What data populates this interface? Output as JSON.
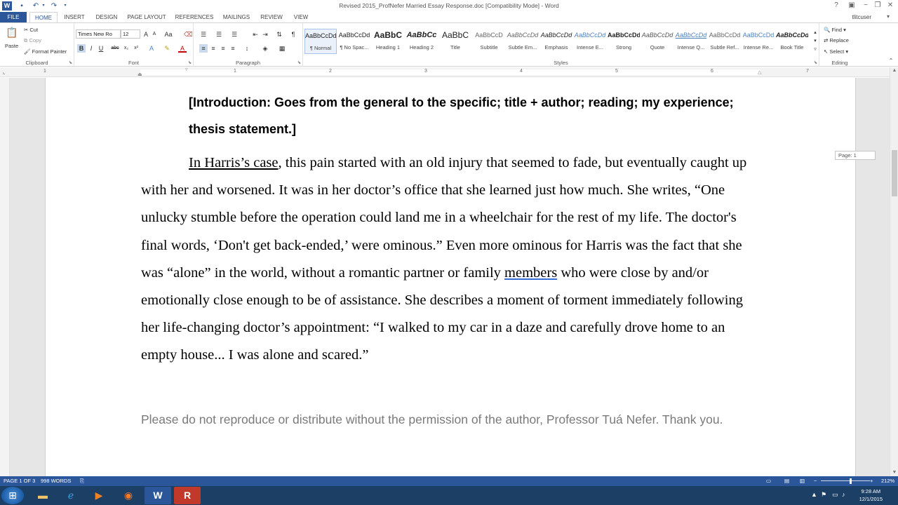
{
  "window": {
    "title": "Revised 2015_ProfNefer Married Essay Response.doc [Compatibility Mode] - Word",
    "user": "tlitcuser",
    "help_icon": "?",
    "minimize": "−",
    "restore": "❐",
    "close": "✕",
    "ribbon_options": "▣"
  },
  "tabs": [
    {
      "label": "FILE"
    },
    {
      "label": "HOME"
    },
    {
      "label": "INSERT"
    },
    {
      "label": "DESIGN"
    },
    {
      "label": "PAGE LAYOUT"
    },
    {
      "label": "REFERENCES"
    },
    {
      "label": "MAILINGS"
    },
    {
      "label": "REVIEW"
    },
    {
      "label": "VIEW"
    }
  ],
  "ribbon": {
    "clipboard": {
      "label": "Clipboard",
      "paste": "Paste",
      "cut": "Cut",
      "copy": "Copy",
      "format_painter": "Format Painter"
    },
    "font": {
      "label": "Font",
      "name": "Times New Ro",
      "size": "12",
      "bold": "B",
      "italic": "I",
      "underline": "U",
      "strike": "abc",
      "sub": "x₂",
      "sup": "x²"
    },
    "paragraph": {
      "label": "Paragraph"
    },
    "styles": {
      "label": "Styles",
      "items": [
        {
          "preview": "AaBbCcDd",
          "name": "¶ Normal"
        },
        {
          "preview": "AaBbCcDd",
          "name": "¶ No Spac..."
        },
        {
          "preview": "AaBbC",
          "name": "Heading 1"
        },
        {
          "preview": "AaBbCc",
          "name": "Heading 2"
        },
        {
          "preview": "AaBbC",
          "name": "Title"
        },
        {
          "preview": "AaBbCcD",
          "name": "Subtitle"
        },
        {
          "preview": "AaBbCcDd",
          "name": "Subtle Em..."
        },
        {
          "preview": "AaBbCcDd",
          "name": "Emphasis"
        },
        {
          "preview": "AaBbCcDd",
          "name": "Intense E..."
        },
        {
          "preview": "AaBbCcDd",
          "name": "Strong"
        },
        {
          "preview": "AaBbCcDd",
          "name": "Quote"
        },
        {
          "preview": "AaBbCcDd",
          "name": "Intense Q..."
        },
        {
          "preview": "AaBbCcDd",
          "name": "Subtle Ref..."
        },
        {
          "preview": "AaBbCcDd",
          "name": "Intense Re..."
        },
        {
          "preview": "AaBbCcDd",
          "name": "Book Title"
        }
      ]
    },
    "editing": {
      "label": "Editing",
      "find": "Find",
      "replace": "Replace",
      "select": "Select"
    }
  },
  "ruler": {
    "numbers": [
      "1",
      "1",
      "2",
      "3",
      "4",
      "5",
      "6",
      "7"
    ]
  },
  "document": {
    "intro_label": "[Introduction: Goes from the general to the specific; title + author; reading; my experience; thesis statement.]",
    "para_underlined_start": "In Harris’s case",
    "para_part1": ", this pain started with an old injury that seemed to fade, but eventually caught up with her and worsened. It was in her doctor’s office that she learned just how much. She writes, “One unlucky stumble before the operation could land me in a wheelchair for the rest of my life. The doctor's final words, ‘Don't get back-ended,’ were ominous.” Even more ominous for Harris was the fact that she was “alone” in the world, without a romantic partner or family ",
    "para_squiggle_word": "members",
    "para_part2": " who were close by and/or emotionally close enough to be of assistance. She describes a moment of torment immediately following her life-changing doctor’s appointment: “I walked to my car in a daze and carefully drove home to an empty house... I was alone and scared.”",
    "footer_note": "Please do not reproduce or distribute without the permission of the author, Professor Tuá Nefer. Thank you.",
    "page_tip": "Page: 1"
  },
  "status": {
    "page": "PAGE 1 OF 3",
    "words": "998 WORDS",
    "zoom": "212%"
  },
  "taskbar": {
    "time": "9:28 AM",
    "date": "12/1/2015"
  },
  "colors": {
    "accent": "#2b579a",
    "taskbar": "#1c3f66"
  }
}
